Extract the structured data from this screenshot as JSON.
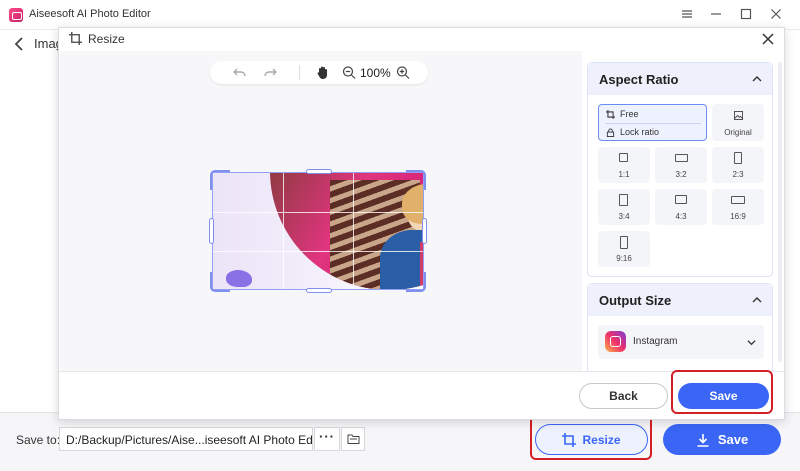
{
  "app": {
    "title": "Aiseesoft AI Photo Editor",
    "behind_title": "Imag"
  },
  "dialog": {
    "title": "Resize",
    "zoom": "100%",
    "back_label": "Back",
    "save_label": "Save"
  },
  "aspect_ratio": {
    "heading": "Aspect Ratio",
    "free_label": "Free",
    "lock_label": "Lock ratio",
    "original_label": "Original",
    "ratios": [
      "1:1",
      "3:2",
      "2:3",
      "3:4",
      "4:3",
      "16:9",
      "9:16"
    ]
  },
  "output_size": {
    "heading": "Output Size",
    "selected": "Instagram"
  },
  "bottom": {
    "save_to_label": "Save to:",
    "path": "D:/Backup/Pictures/Aise...iseesoft AI Photo Editor",
    "more": "···",
    "resize_label": "Resize",
    "save_label": "Save"
  },
  "colors": {
    "accent": "#3b66f5",
    "highlight": "#d32026"
  }
}
